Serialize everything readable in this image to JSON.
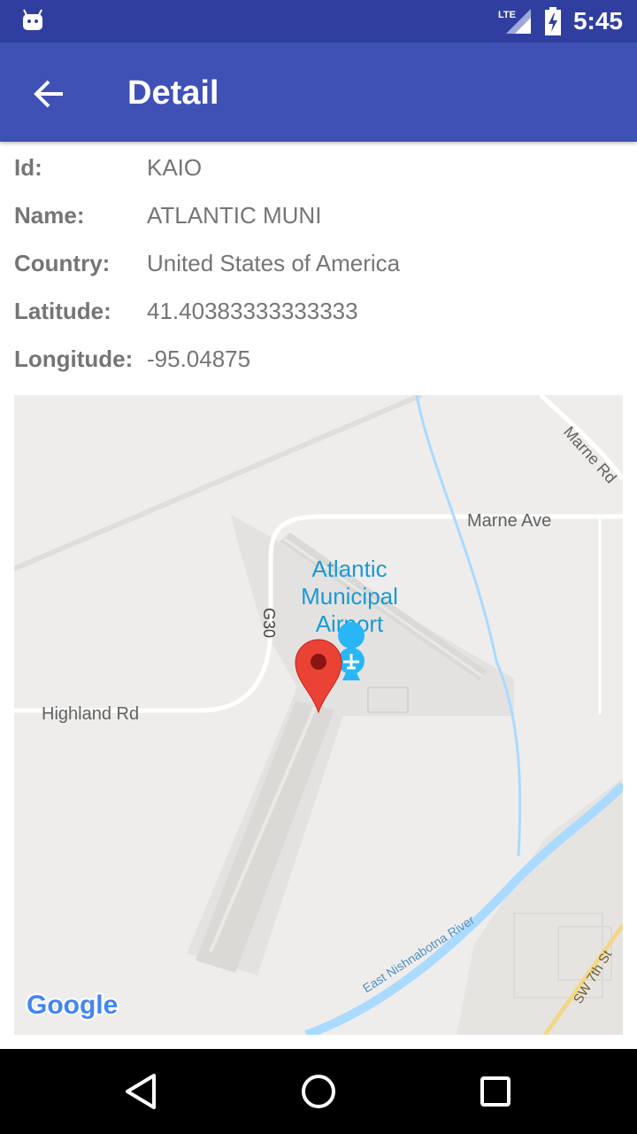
{
  "status_bar": {
    "time": "5:45",
    "network": "LTE",
    "icons": [
      "android-icon",
      "lte-signal-icon",
      "battery-charging-icon"
    ]
  },
  "app_bar": {
    "title": "Detail",
    "back_icon": "arrow-left-icon"
  },
  "details": [
    {
      "label": "Id:",
      "value": "KAIO"
    },
    {
      "label": "Name:",
      "value": "ATLANTIC MUNI"
    },
    {
      "label": "Country:",
      "value": "United States of America"
    },
    {
      "label": "Latitude:",
      "value": "41.40383333333333"
    },
    {
      "label": "Longitude:",
      "value": "-95.04875"
    }
  ],
  "map": {
    "airport_label_1": "Atlantic",
    "airport_label_2": "Municipal",
    "airport_label_3": "Airport",
    "road_marne_ave": "Marne Ave",
    "road_marne_rd": "Marne Rd",
    "road_g30": "G30",
    "road_highland": "Highland Rd",
    "river": "East Nishnabotna River",
    "road_sw7th": "SW 7th St",
    "logo": "Google",
    "marker_icon": "map-pin-icon",
    "airport_icon": "airplane-icon",
    "colors": {
      "pin": "#ea4335",
      "water": "#aadaff",
      "airport": "#e4e2e0",
      "label": "#1a9ad6"
    }
  },
  "nav_bar": {
    "icons": [
      "back-triangle-icon",
      "home-circle-icon",
      "recents-square-icon"
    ]
  }
}
